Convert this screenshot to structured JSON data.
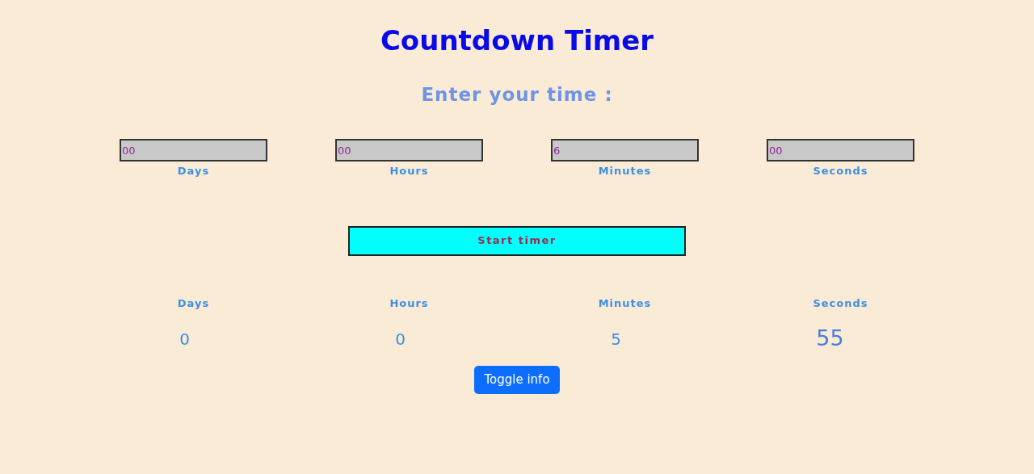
{
  "title": "Countdown Timer",
  "prompt": "Enter your time :",
  "inputs": [
    {
      "value": "00",
      "label": "Days"
    },
    {
      "value": "00",
      "label": "Hours"
    },
    {
      "value": "6",
      "label": "Minutes"
    },
    {
      "value": "00",
      "label": "Seconds"
    }
  ],
  "start_button": "Start timer",
  "display": [
    {
      "label": "Days",
      "value": "0",
      "large": false
    },
    {
      "label": "Hours",
      "value": "0",
      "large": false
    },
    {
      "label": "Minutes",
      "value": "5",
      "large": false
    },
    {
      "label": "Seconds",
      "value": "55",
      "large": true
    }
  ],
  "toggle_button": "Toggle info"
}
